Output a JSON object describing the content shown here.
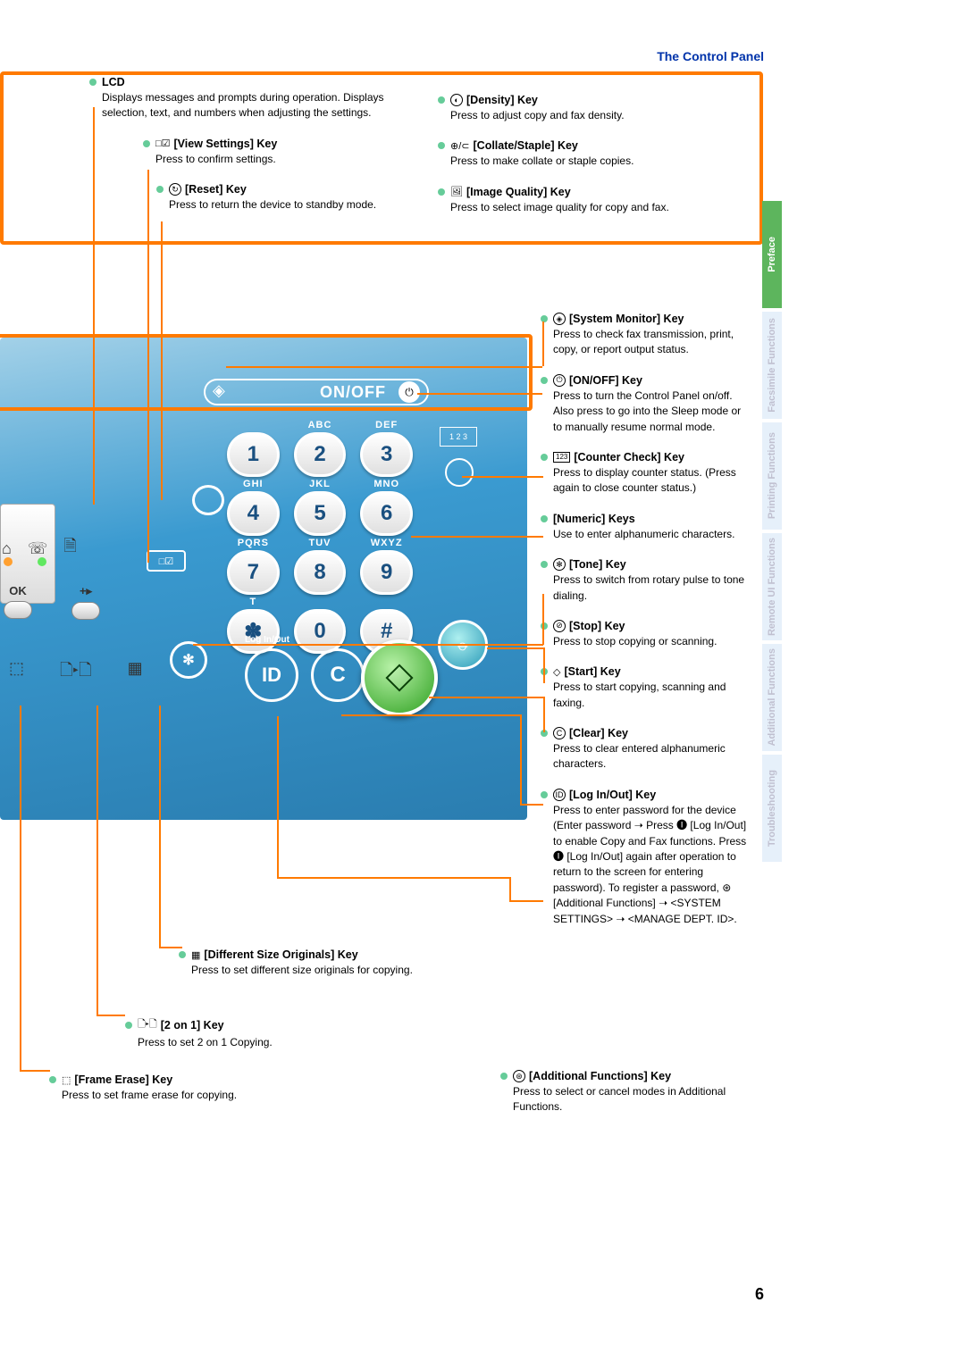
{
  "page_title": "The Control Panel",
  "page_number": "6",
  "tabs": [
    "Preface",
    "Facsimile\nFunctions",
    "Printing\nFunctions",
    "Remote UI\nFunctions",
    "Additional\nFunctions",
    "Troubleshooting"
  ],
  "panel": {
    "onoff_label": "ON/OFF",
    "keypad_labels_row1": [
      "",
      "ABC",
      "DEF"
    ],
    "keypad_labels_row2": [
      "GHI",
      "JKL",
      "MNO"
    ],
    "keypad_labels_row3": [
      "PQRS",
      "TUV",
      "WXYZ"
    ],
    "keypad_labels_row4": [
      "T",
      "",
      ""
    ],
    "numkeys_row1": [
      "1",
      "2",
      "3"
    ],
    "numkeys_row2": [
      "4",
      "5",
      "6"
    ],
    "numkeys_row3": [
      "7",
      "8",
      "9"
    ],
    "numkeys_row4": [
      "✽",
      "0",
      "#"
    ],
    "counter_label": "1 2 3",
    "loginout_label": "Log In/Out",
    "viewsettings_sym": "□☑",
    "ok_label": "OK",
    "nav_right": "+▸",
    "id_label": "ID",
    "c_label": "C",
    "tone_sym": "✻"
  },
  "left": {
    "lcd_title": "LCD",
    "lcd_desc": "Displays messages and prompts during operation. Displays selection, text, and numbers when adjusting the settings.",
    "view_title": "[View Settings] Key",
    "view_desc": "Press to confirm settings.",
    "reset_title": "[Reset] Key",
    "reset_desc": "Press to return the device to standby mode."
  },
  "right_top": {
    "density_title": "[Density] Key",
    "density_desc": "Press to adjust copy and fax density.",
    "collate_title": "[Collate/Staple] Key",
    "collate_desc": "Press to make collate or staple copies.",
    "iq_title": "[Image Quality] Key",
    "iq_desc": "Press to select image quality for copy and fax."
  },
  "right": {
    "sysmon_title": "[System Monitor] Key",
    "sysmon_desc": "Press to check fax transmission, print, copy, or report output status.",
    "onoff_title": "[ON/OFF] Key",
    "onoff_desc": "Press to turn the Control Panel on/off. Also press to go into the Sleep mode or to manually resume normal mode.",
    "counter_title": "[Counter Check] Key",
    "counter_desc": "Press to display counter status. (Press again to close counter status.)",
    "numpad_title": "[Numeric] Keys",
    "numpad_desc": "Use to enter alphanumeric characters.",
    "tone_title": "[Tone] Key",
    "tone_desc": "Press to switch from rotary pulse to tone dialing.",
    "stop_title": "[Stop] Key",
    "stop_desc": "Press to stop copying or scanning.",
    "start_title": "[Start] Key",
    "start_desc": "Press to start copying, scanning and faxing.",
    "clear_title": "[Clear] Key",
    "clear_desc": "Press to clear entered alphanumeric characters.",
    "login_title": "[Log In/Out] Key",
    "login_desc": "Press to enter password for the device (Enter password ➝ Press 🅘 [Log In/Out] to enable Copy and Fax functions. Press 🅘 [Log In/Out] again after operation to return to the screen for entering password). To register a password, ⊛ [Additional Functions] ➝ <SYSTEM SETTINGS> ➝ <MANAGE DEPT. ID>.",
    "addfunc_title": "[Additional Functions] Key",
    "addfunc_desc": "Press to select or cancel modes in Additional Functions."
  },
  "bottom": {
    "diff_title": "[Different Size Originals] Key",
    "diff_desc": "Press to set different size originals for copying.",
    "twoon1_title": "[2 on 1] Key",
    "twoon1_desc": "Press to set 2 on 1 Copying.",
    "frame_title": "[Frame Erase] Key",
    "frame_desc": "Press to set frame erase for copying."
  },
  "key_icons": {
    "density": "◐",
    "collate": "⊕/⊂",
    "image_quality": "🖼",
    "sysmon": "◈",
    "onoff": "⏻",
    "counter": "123",
    "tone": "✻",
    "stop": "⊘",
    "start": "◇",
    "clear": "Ⓒ",
    "login": "🅘",
    "addfunc": "⊛",
    "viewsettings": "□☑",
    "reset": "⊘",
    "diff": "▦",
    "twoon1": "🗋▸🗋",
    "frame": "⬚"
  },
  "chart_data": null
}
